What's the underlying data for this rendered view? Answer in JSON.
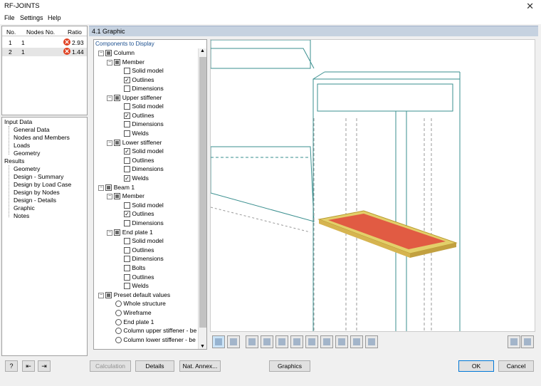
{
  "window": {
    "title": "RF-JOINTS",
    "close": "✕"
  },
  "menu": [
    "File",
    "Settings",
    "Help"
  ],
  "nodes_table": {
    "headers": {
      "no": "No.",
      "nodes": "Nodes No.",
      "ratio": "Ratio"
    },
    "rows": [
      {
        "no": "1",
        "nodes": "1",
        "ratio": "2.93"
      },
      {
        "no": "2",
        "nodes": "1",
        "ratio": "1.44"
      }
    ]
  },
  "nav": {
    "input_header": "Input Data",
    "input": [
      "General Data",
      "Nodes and Members",
      "Loads",
      "Geometry"
    ],
    "results_header": "Results",
    "results": [
      "Geometry",
      "Design - Summary",
      "Design by Load Case",
      "Design by Nodes",
      "Design - Details",
      "Graphic",
      "Notes"
    ]
  },
  "panel": {
    "title": "4.1 Graphic",
    "components_caption": "Components to Display"
  },
  "tree": {
    "column": "Column",
    "member": "Member",
    "solid_model": "Solid model",
    "outlines": "Outlines",
    "dimensions": "Dimensions",
    "upper_stiffener": "Upper stiffener",
    "welds": "Welds",
    "lower_stiffener": "Lower stiffener",
    "beam1": "Beam 1",
    "end_plate1": "End plate 1",
    "bolts": "Bolts",
    "preset": "Preset default values",
    "whole": "Whole structure",
    "wireframe": "Wireframe",
    "end_plate_1": "End plate 1",
    "col_upper": "Column upper stiffener - be",
    "col_lower": "Column lower stiffener - be"
  },
  "buttons": {
    "calculation": "Calculation",
    "details": "Details",
    "nat_annex": "Nat. Annex...",
    "graphics": "Graphics",
    "ok": "OK",
    "cancel": "Cancel"
  },
  "colors": {
    "column_outline": "#3a8f8f",
    "plate_fill": "#e3cf6a",
    "weld": "#e0463c"
  }
}
